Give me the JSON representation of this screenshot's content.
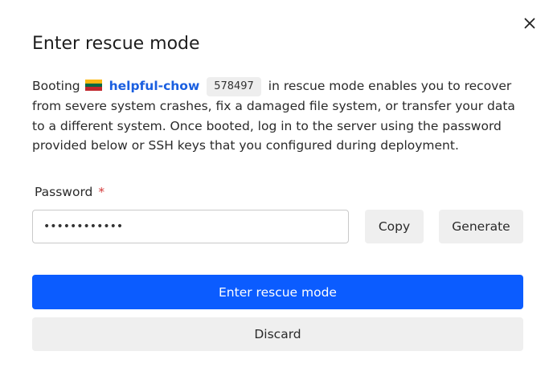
{
  "dialog": {
    "title": "Enter rescue mode",
    "close_icon": "close-icon"
  },
  "description": {
    "prefix": "Booting",
    "flag_icon": "lithuania-flag-icon",
    "flag_colors": [
      "#FDB913",
      "#006A44",
      "#C1272D"
    ],
    "server_name": "helpful-chow",
    "server_id": "578497",
    "suffix": "in rescue mode enables you to recover from severe system crashes, fix a damaged file system, or transfer your data to a different system. Once booted, log in to the server using the password provided below or SSH keys that you configured during deployment."
  },
  "password": {
    "label": "Password",
    "required_marker": "*",
    "value": "••••••••••••"
  },
  "buttons": {
    "copy": "Copy",
    "generate": "Generate",
    "enter": "Enter rescue mode",
    "discard": "Discard"
  },
  "colors": {
    "primary": "#0B5CFF",
    "link": "#1A5FE0",
    "required": "#D43B3B"
  }
}
